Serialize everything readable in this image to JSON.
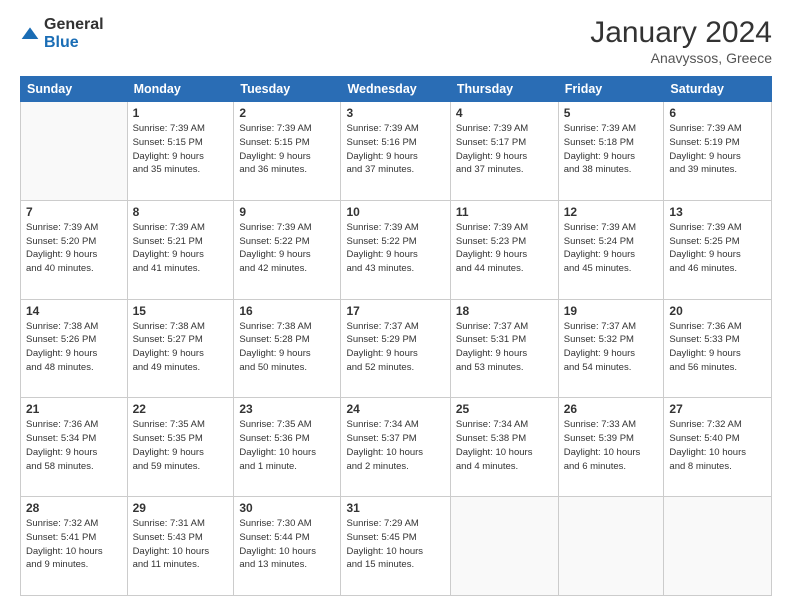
{
  "header": {
    "logo_general": "General",
    "logo_blue": "Blue",
    "month": "January 2024",
    "location": "Anavyssos, Greece"
  },
  "days_of_week": [
    "Sunday",
    "Monday",
    "Tuesday",
    "Wednesday",
    "Thursday",
    "Friday",
    "Saturday"
  ],
  "weeks": [
    [
      {
        "day": "",
        "info": ""
      },
      {
        "day": "1",
        "info": "Sunrise: 7:39 AM\nSunset: 5:15 PM\nDaylight: 9 hours\nand 35 minutes."
      },
      {
        "day": "2",
        "info": "Sunrise: 7:39 AM\nSunset: 5:15 PM\nDaylight: 9 hours\nand 36 minutes."
      },
      {
        "day": "3",
        "info": "Sunrise: 7:39 AM\nSunset: 5:16 PM\nDaylight: 9 hours\nand 37 minutes."
      },
      {
        "day": "4",
        "info": "Sunrise: 7:39 AM\nSunset: 5:17 PM\nDaylight: 9 hours\nand 37 minutes."
      },
      {
        "day": "5",
        "info": "Sunrise: 7:39 AM\nSunset: 5:18 PM\nDaylight: 9 hours\nand 38 minutes."
      },
      {
        "day": "6",
        "info": "Sunrise: 7:39 AM\nSunset: 5:19 PM\nDaylight: 9 hours\nand 39 minutes."
      }
    ],
    [
      {
        "day": "7",
        "info": "Sunrise: 7:39 AM\nSunset: 5:20 PM\nDaylight: 9 hours\nand 40 minutes."
      },
      {
        "day": "8",
        "info": "Sunrise: 7:39 AM\nSunset: 5:21 PM\nDaylight: 9 hours\nand 41 minutes."
      },
      {
        "day": "9",
        "info": "Sunrise: 7:39 AM\nSunset: 5:22 PM\nDaylight: 9 hours\nand 42 minutes."
      },
      {
        "day": "10",
        "info": "Sunrise: 7:39 AM\nSunset: 5:22 PM\nDaylight: 9 hours\nand 43 minutes."
      },
      {
        "day": "11",
        "info": "Sunrise: 7:39 AM\nSunset: 5:23 PM\nDaylight: 9 hours\nand 44 minutes."
      },
      {
        "day": "12",
        "info": "Sunrise: 7:39 AM\nSunset: 5:24 PM\nDaylight: 9 hours\nand 45 minutes."
      },
      {
        "day": "13",
        "info": "Sunrise: 7:39 AM\nSunset: 5:25 PM\nDaylight: 9 hours\nand 46 minutes."
      }
    ],
    [
      {
        "day": "14",
        "info": "Sunrise: 7:38 AM\nSunset: 5:26 PM\nDaylight: 9 hours\nand 48 minutes."
      },
      {
        "day": "15",
        "info": "Sunrise: 7:38 AM\nSunset: 5:27 PM\nDaylight: 9 hours\nand 49 minutes."
      },
      {
        "day": "16",
        "info": "Sunrise: 7:38 AM\nSunset: 5:28 PM\nDaylight: 9 hours\nand 50 minutes."
      },
      {
        "day": "17",
        "info": "Sunrise: 7:37 AM\nSunset: 5:29 PM\nDaylight: 9 hours\nand 52 minutes."
      },
      {
        "day": "18",
        "info": "Sunrise: 7:37 AM\nSunset: 5:31 PM\nDaylight: 9 hours\nand 53 minutes."
      },
      {
        "day": "19",
        "info": "Sunrise: 7:37 AM\nSunset: 5:32 PM\nDaylight: 9 hours\nand 54 minutes."
      },
      {
        "day": "20",
        "info": "Sunrise: 7:36 AM\nSunset: 5:33 PM\nDaylight: 9 hours\nand 56 minutes."
      }
    ],
    [
      {
        "day": "21",
        "info": "Sunrise: 7:36 AM\nSunset: 5:34 PM\nDaylight: 9 hours\nand 58 minutes."
      },
      {
        "day": "22",
        "info": "Sunrise: 7:35 AM\nSunset: 5:35 PM\nDaylight: 9 hours\nand 59 minutes."
      },
      {
        "day": "23",
        "info": "Sunrise: 7:35 AM\nSunset: 5:36 PM\nDaylight: 10 hours\nand 1 minute."
      },
      {
        "day": "24",
        "info": "Sunrise: 7:34 AM\nSunset: 5:37 PM\nDaylight: 10 hours\nand 2 minutes."
      },
      {
        "day": "25",
        "info": "Sunrise: 7:34 AM\nSunset: 5:38 PM\nDaylight: 10 hours\nand 4 minutes."
      },
      {
        "day": "26",
        "info": "Sunrise: 7:33 AM\nSunset: 5:39 PM\nDaylight: 10 hours\nand 6 minutes."
      },
      {
        "day": "27",
        "info": "Sunrise: 7:32 AM\nSunset: 5:40 PM\nDaylight: 10 hours\nand 8 minutes."
      }
    ],
    [
      {
        "day": "28",
        "info": "Sunrise: 7:32 AM\nSunset: 5:41 PM\nDaylight: 10 hours\nand 9 minutes."
      },
      {
        "day": "29",
        "info": "Sunrise: 7:31 AM\nSunset: 5:43 PM\nDaylight: 10 hours\nand 11 minutes."
      },
      {
        "day": "30",
        "info": "Sunrise: 7:30 AM\nSunset: 5:44 PM\nDaylight: 10 hours\nand 13 minutes."
      },
      {
        "day": "31",
        "info": "Sunrise: 7:29 AM\nSunset: 5:45 PM\nDaylight: 10 hours\nand 15 minutes."
      },
      {
        "day": "",
        "info": ""
      },
      {
        "day": "",
        "info": ""
      },
      {
        "day": "",
        "info": ""
      }
    ]
  ]
}
